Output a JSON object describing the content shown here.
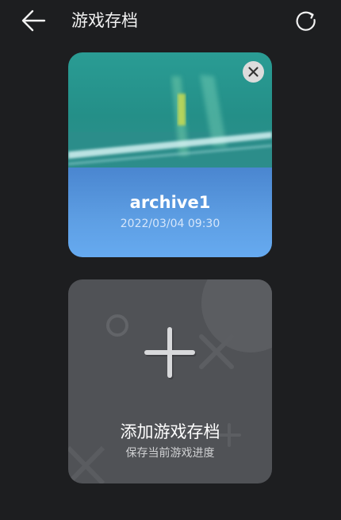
{
  "header": {
    "title": "游戏存档",
    "back_icon": "arrow-left-icon",
    "refresh_icon": "refresh-icon"
  },
  "saves": [
    {
      "name": "archive1",
      "timestamp": "2022/03/04 09:30",
      "delete_icon": "close-icon"
    }
  ],
  "add_save": {
    "title": "添加游戏存档",
    "subtitle": "保存当前游戏进度",
    "icon": "plus-icon"
  },
  "colors": {
    "background": "#1d1e20",
    "save_card_blue": "#5e9fe4",
    "add_card_gray": "#505256"
  }
}
